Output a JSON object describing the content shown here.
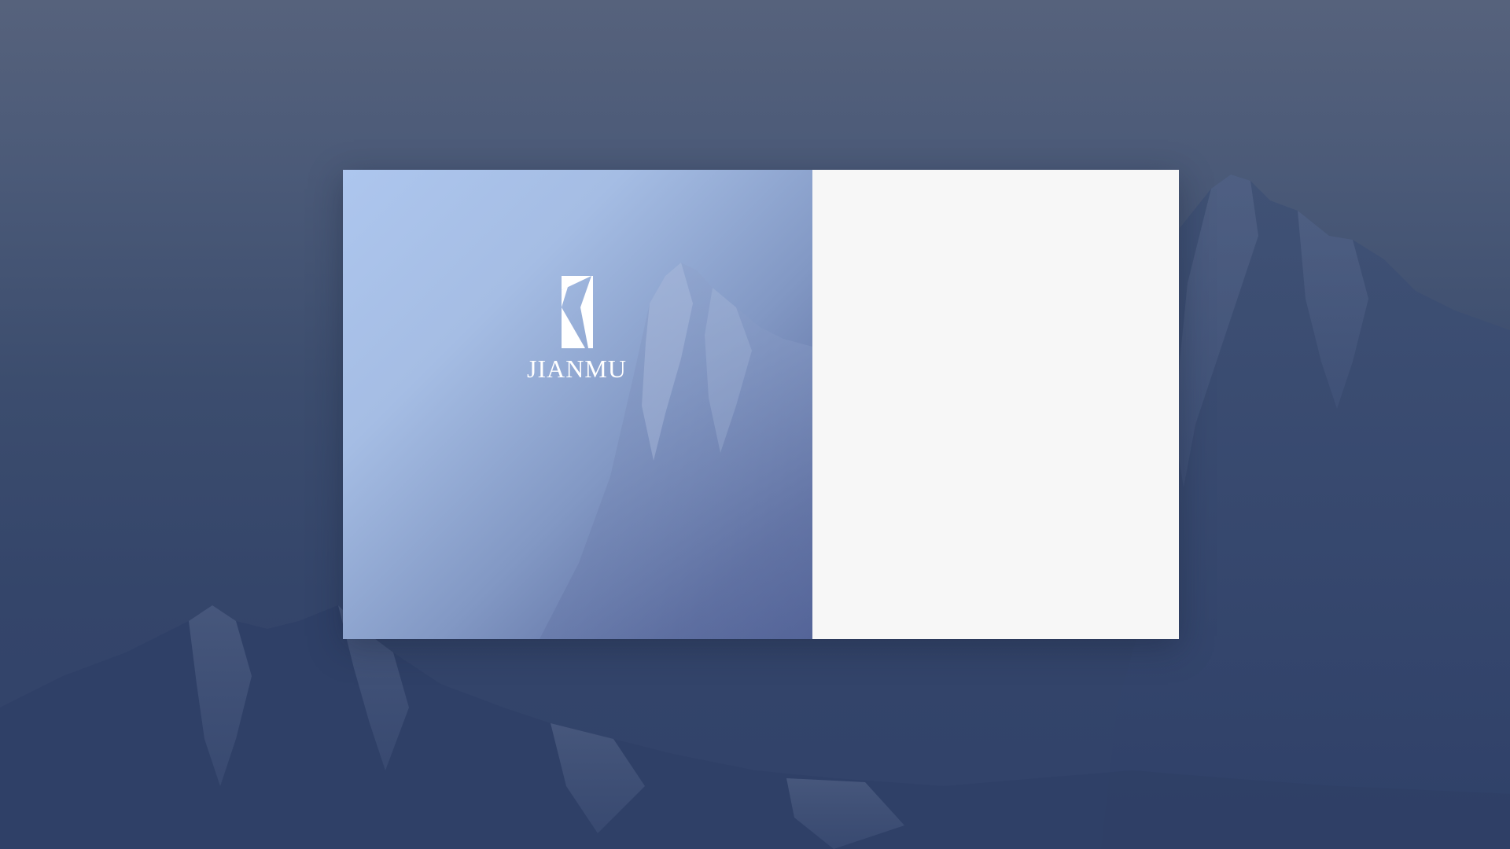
{
  "background": {
    "scene": "snow-mountain",
    "overlay_color": "#34456a"
  },
  "brand": {
    "logo_icon": "jianmu-logo-icon",
    "name": "JIANMU",
    "panel_gradient": [
      "#adc6ee",
      "#4f5f94"
    ]
  },
  "form_panel": {
    "background": "#f7f7f7"
  }
}
